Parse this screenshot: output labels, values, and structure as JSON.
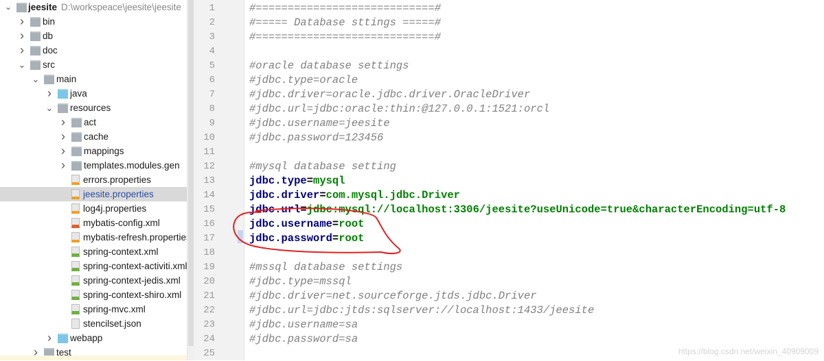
{
  "project": {
    "name": "jeesite",
    "path": "D:\\workspeace\\jeesite\\jeesite"
  },
  "tree": [
    {
      "label": "bin",
      "depth": 1,
      "type": "folder",
      "chev": "closed"
    },
    {
      "label": "db",
      "depth": 1,
      "type": "folder",
      "chev": "closed"
    },
    {
      "label": "doc",
      "depth": 1,
      "type": "folder",
      "chev": "closed"
    },
    {
      "label": "src",
      "depth": 1,
      "type": "folder",
      "chev": "open"
    },
    {
      "label": "main",
      "depth": 2,
      "type": "folder",
      "chev": "open"
    },
    {
      "label": "java",
      "depth": 3,
      "type": "src",
      "chev": "closed"
    },
    {
      "label": "resources",
      "depth": 3,
      "type": "folder",
      "chev": "open"
    },
    {
      "label": "act",
      "depth": 4,
      "type": "folder",
      "chev": "closed"
    },
    {
      "label": "cache",
      "depth": 4,
      "type": "folder",
      "chev": "closed"
    },
    {
      "label": "mappings",
      "depth": 4,
      "type": "folder",
      "chev": "closed"
    },
    {
      "label": "templates.modules.gen",
      "depth": 4,
      "type": "folder",
      "chev": "closed"
    },
    {
      "label": "errors.properties",
      "depth": 5,
      "type": "props"
    },
    {
      "label": "jeesite.properties",
      "depth": 5,
      "type": "props",
      "selected": true
    },
    {
      "label": "log4j.properties",
      "depth": 5,
      "type": "props"
    },
    {
      "label": "mybatis-config.xml",
      "depth": 5,
      "type": "xml"
    },
    {
      "label": "mybatis-refresh.properties",
      "depth": 5,
      "type": "props"
    },
    {
      "label": "spring-context.xml",
      "depth": 5,
      "type": "spring"
    },
    {
      "label": "spring-context-activiti.xml",
      "depth": 5,
      "type": "spring"
    },
    {
      "label": "spring-context-jedis.xml",
      "depth": 5,
      "type": "spring"
    },
    {
      "label": "spring-context-shiro.xml",
      "depth": 5,
      "type": "spring"
    },
    {
      "label": "spring-mvc.xml",
      "depth": 5,
      "type": "spring"
    },
    {
      "label": "stencilset.json",
      "depth": 5,
      "type": "json"
    },
    {
      "label": "webapp",
      "depth": 3,
      "type": "web",
      "chev": "closed"
    },
    {
      "label": "test",
      "depth": 2,
      "type": "folder",
      "chev": "closed"
    }
  ],
  "editor": {
    "lines": [
      {
        "c": "#============================#"
      },
      {
        "c": "#===== Database sttings =====#"
      },
      {
        "c": "#============================#"
      },
      {
        "c": ""
      },
      {
        "c": "#oracle database settings"
      },
      {
        "c": "#jdbc.type=oracle"
      },
      {
        "c": "#jdbc.driver=oracle.jdbc.driver.OracleDriver"
      },
      {
        "c": "#jdbc.url=jdbc:oracle:thin:@127.0.0.1:1521:orcl"
      },
      {
        "c": "#jdbc.username=jeesite"
      },
      {
        "c": "#jdbc.password=123456"
      },
      {
        "c": ""
      },
      {
        "c": "#mysql database setting"
      },
      {
        "k": "jdbc.type",
        "v": "mysql"
      },
      {
        "k": "jdbc.driver",
        "v": "com.mysql.jdbc.Driver"
      },
      {
        "k": "jdbc.url",
        "v": "jdbc:mysql://localhost:3306/jeesite?useUnicode=true&characterEncoding=utf-8"
      },
      {
        "k": "jdbc.username",
        "v": "root"
      },
      {
        "k": "jdbc.password",
        "v": "root"
      },
      {
        "c": ""
      },
      {
        "c": "#mssql database settings"
      },
      {
        "c": "#jdbc.type=mssql"
      },
      {
        "c": "#jdbc.driver=net.sourceforge.jtds.jdbc.Driver"
      },
      {
        "c": "#jdbc.url=jdbc:jtds:sqlserver://localhost:1433/jeesite"
      },
      {
        "c": "#jdbc.username=sa"
      },
      {
        "c": "#jdbc.password=sa"
      },
      {
        "c": ""
      }
    ]
  },
  "watermark": "https://blog.csdn.net/weixin_40909009",
  "colors": {
    "key": "#000080",
    "value": "#008000",
    "comment": "#808080",
    "annotation": "#e02020"
  }
}
